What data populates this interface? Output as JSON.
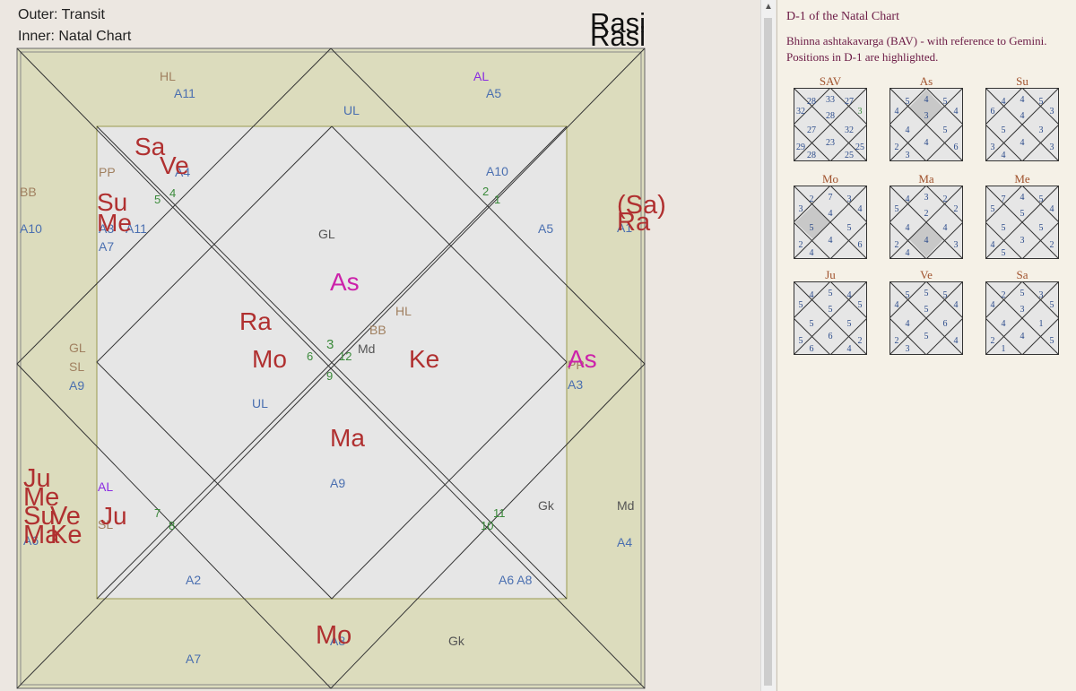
{
  "header": {
    "outer": "Outer: Transit",
    "inner": "Inner: Natal Chart",
    "rasi_title": "Rasi"
  },
  "colors": {
    "outer_fill": "#dcdcbd",
    "inner_fill": "#e6e6e6",
    "red": "#b03030",
    "blue": "#4a6fb0",
    "green": "#3a8a3a",
    "brown": "#a08060",
    "purple": "#8a2be2",
    "magenta": "#cc22aa"
  },
  "outer_labels": [
    {
      "id": "hl-top",
      "text": "HL",
      "color": "brown"
    },
    {
      "id": "a11-top",
      "text": "A11",
      "color": "blue"
    },
    {
      "id": "al-top",
      "text": "AL",
      "color": "purple"
    },
    {
      "id": "a5-top",
      "text": "A5",
      "color": "blue"
    },
    {
      "id": "bb-left",
      "text": "BB",
      "color": "brown"
    },
    {
      "id": "a10-left",
      "text": "A10",
      "color": "blue"
    },
    {
      "id": "gl-left",
      "text": "GL",
      "color": "brown"
    },
    {
      "id": "sl-left",
      "text": "SL",
      "color": "brown"
    },
    {
      "id": "a9-left",
      "text": "A9",
      "color": "blue"
    },
    {
      "id": "md-right",
      "text": "Md",
      "color": "dark"
    },
    {
      "id": "a4-right",
      "text": "A4",
      "color": "blue"
    },
    {
      "id": "gk-bottom",
      "text": "Gk",
      "color": "dark"
    },
    {
      "id": "a7-bottom",
      "text": "A7",
      "color": "blue"
    },
    {
      "id": "a6-bl",
      "text": "A6",
      "color": "blue"
    },
    {
      "id": "a1-right",
      "text": "A1",
      "color": "blue"
    },
    {
      "id": "a8-bottom",
      "text": "A8",
      "color": "blue"
    }
  ],
  "outer_planets": [
    {
      "id": "ju-t",
      "text": "Ju"
    },
    {
      "id": "me-t",
      "text": "Me"
    },
    {
      "id": "su-t",
      "text": "Su"
    },
    {
      "id": "ve-t",
      "text": "Ve"
    },
    {
      "id": "ma-t",
      "text": "Ma"
    },
    {
      "id": "ke-t",
      "text": "Ke"
    },
    {
      "id": "sa-t",
      "text": "(Sa)"
    },
    {
      "id": "ra-t",
      "text": "Ra"
    },
    {
      "id": "mo-t",
      "text": "Mo"
    }
  ],
  "inner_labels": [
    {
      "id": "ul-top",
      "text": "UL",
      "color": "blue"
    },
    {
      "id": "pp-tl",
      "text": "PP",
      "color": "brown"
    },
    {
      "id": "a4-tl",
      "text": "A4",
      "color": "blue"
    },
    {
      "id": "a3-tl",
      "text": "A3",
      "color": "blue"
    },
    {
      "id": "a11-tl",
      "text": "A11",
      "color": "blue"
    },
    {
      "id": "a7-tl",
      "text": "A7",
      "color": "blue"
    },
    {
      "id": "a10-in",
      "text": "A10",
      "color": "blue"
    },
    {
      "id": "a5-in",
      "text": "A5",
      "color": "blue"
    },
    {
      "id": "gl-in",
      "text": "GL",
      "color": "dark"
    },
    {
      "id": "hl-in",
      "text": "HL",
      "color": "brown"
    },
    {
      "id": "bb-in",
      "text": "BB",
      "color": "brown"
    },
    {
      "id": "md-in",
      "text": "Md",
      "color": "dark"
    },
    {
      "id": "pp-r",
      "text": "PP",
      "color": "brown"
    },
    {
      "id": "a3-r",
      "text": "A3",
      "color": "blue"
    },
    {
      "id": "ul-in",
      "text": "UL",
      "color": "blue"
    },
    {
      "id": "a9-in",
      "text": "A9",
      "color": "blue"
    },
    {
      "id": "al-bl",
      "text": "AL",
      "color": "purple"
    },
    {
      "id": "sl-bl",
      "text": "SL",
      "color": "brown"
    },
    {
      "id": "gk-in",
      "text": "Gk",
      "color": "dark"
    },
    {
      "id": "a2-in",
      "text": "A2",
      "color": "blue"
    },
    {
      "id": "a6a8-in",
      "text": "A6 A8",
      "color": "blue"
    }
  ],
  "inner_planets": [
    {
      "id": "sa-n",
      "text": "Sa",
      "color": "red"
    },
    {
      "id": "ve-n",
      "text": "Ve",
      "color": "red"
    },
    {
      "id": "su-n",
      "text": "Su",
      "color": "red"
    },
    {
      "id": "me-n",
      "text": "Me",
      "color": "red"
    },
    {
      "id": "as-n",
      "text": "As",
      "color": "magenta"
    },
    {
      "id": "ra-n",
      "text": "Ra",
      "color": "red"
    },
    {
      "id": "mo-n",
      "text": "Mo",
      "color": "red"
    },
    {
      "id": "ke-n",
      "text": "Ke",
      "color": "red"
    },
    {
      "id": "as-r",
      "text": "As",
      "color": "magenta"
    },
    {
      "id": "ma-n",
      "text": "Ma",
      "color": "red"
    },
    {
      "id": "ju-n",
      "text": "Ju",
      "color": "red"
    }
  ],
  "house_numbers": [
    {
      "id": "h3",
      "text": "3"
    },
    {
      "id": "h12",
      "text": "12"
    },
    {
      "id": "h6",
      "text": "6"
    },
    {
      "id": "h9",
      "text": "9"
    },
    {
      "id": "h5",
      "text": "5"
    },
    {
      "id": "h4",
      "text": "4"
    },
    {
      "id": "h2",
      "text": "2"
    },
    {
      "id": "h1",
      "text": "1"
    },
    {
      "id": "h7",
      "text": "7"
    },
    {
      "id": "h8",
      "text": "8"
    },
    {
      "id": "h11",
      "text": "11"
    },
    {
      "id": "h10",
      "text": "10"
    }
  ],
  "panel": {
    "title": "D-1 of the Natal Chart",
    "desc1": "Bhinna ashtakavarga (BAV) - with reference to Gemini.",
    "desc2": "Positions in D-1 are highlighted."
  },
  "bav": [
    {
      "name": "SAV",
      "nums": [
        "28",
        "33",
        "27",
        "32",
        "28",
        "3",
        "27",
        "32",
        "29",
        "23",
        "25",
        "28",
        "25"
      ]
    },
    {
      "name": "As",
      "nums": [
        "5",
        "4",
        "5",
        "4",
        "3",
        "4",
        "4",
        "5",
        "2",
        "4",
        "6",
        "3"
      ],
      "hl": "top"
    },
    {
      "name": "Su",
      "nums": [
        "4",
        "4",
        "5",
        "6",
        "4",
        "3",
        "5",
        "3",
        "3",
        "4",
        "3",
        "4"
      ],
      "hl": "none"
    },
    {
      "name": "Mo",
      "nums": [
        "2",
        "7",
        "3",
        "3",
        "4",
        "4",
        "5",
        "5",
        "2",
        "4",
        "6",
        "4"
      ],
      "hl": "left"
    },
    {
      "name": "Ma",
      "nums": [
        "4",
        "3",
        "2",
        "5",
        "2",
        "2",
        "4",
        "4",
        "2",
        "4",
        "3",
        "4"
      ],
      "hl": "bottom"
    },
    {
      "name": "Me",
      "nums": [
        "7",
        "4",
        "5",
        "5",
        "5",
        "4",
        "5",
        "5",
        "4",
        "3",
        "2",
        "5"
      ],
      "hl": "none"
    },
    {
      "name": "Ju",
      "nums": [
        "4",
        "5",
        "4",
        "5",
        "5",
        "5",
        "5",
        "5",
        "5",
        "6",
        "2",
        "6",
        "4"
      ],
      "hl": "none"
    },
    {
      "name": "Ve",
      "nums": [
        "5",
        "5",
        "5",
        "4",
        "5",
        "4",
        "4",
        "6",
        "2",
        "5",
        "4",
        "3"
      ],
      "hl": "none"
    },
    {
      "name": "Sa",
      "nums": [
        "2",
        "5",
        "3",
        "4",
        "3",
        "5",
        "4",
        "1",
        "2",
        "4",
        "5",
        "1"
      ],
      "hl": "none"
    }
  ]
}
